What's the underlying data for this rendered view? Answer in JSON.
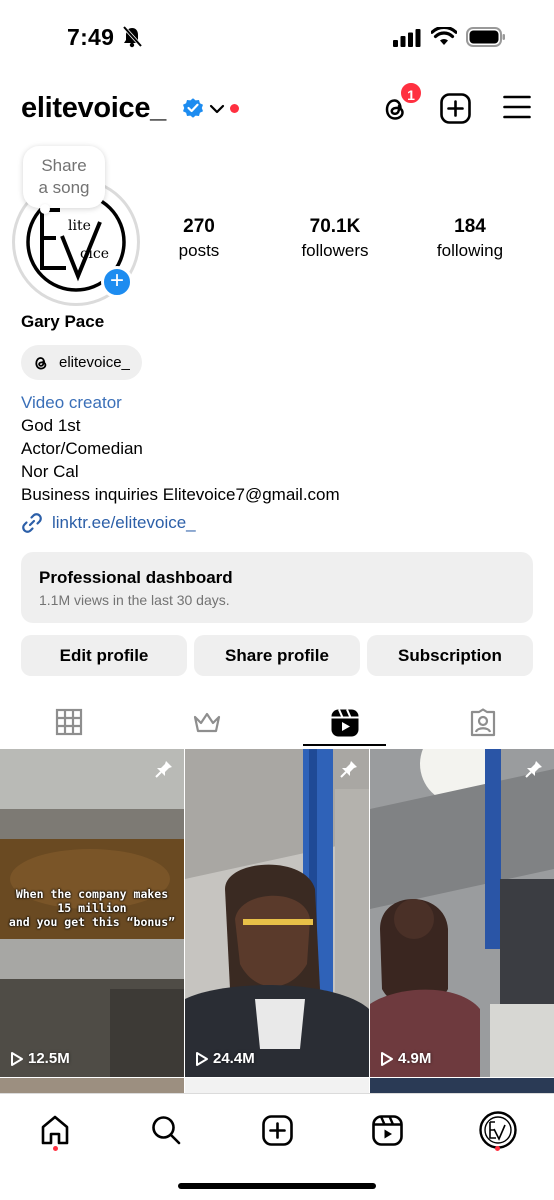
{
  "status_bar": {
    "time": "7:49"
  },
  "header": {
    "username": "elitevoice_",
    "threads_badge": "1",
    "icons": [
      "verified-badge-icon",
      "chevron-down-icon",
      "threads-icon",
      "new-post-icon",
      "menu-icon"
    ]
  },
  "note": {
    "text_line1": "Share",
    "text_line2": "a song"
  },
  "profile": {
    "stats": [
      {
        "value": "270",
        "label": "posts"
      },
      {
        "value": "70.1K",
        "label": "followers"
      },
      {
        "value": "184",
        "label": "following"
      }
    ],
    "full_name": "Gary Pace",
    "threads_handle": "elitevoice_",
    "category": "Video creator",
    "bio_lines": [
      "God 1st",
      "Actor/Comedian",
      "Nor Cal",
      "Business inquiries Elitevoice7@gmail.com"
    ],
    "link": "linktr.ee/elitevoice_"
  },
  "dashboard": {
    "title": "Professional dashboard",
    "subtitle": "1.1M views in the last 30 days."
  },
  "actions": {
    "edit": "Edit profile",
    "share": "Share profile",
    "subscription": "Subscription"
  },
  "tabs": {
    "active": "reels",
    "items": [
      "grid",
      "subscriptions",
      "reels",
      "tagged"
    ]
  },
  "posts": [
    {
      "views": "12.5M",
      "pinned": true,
      "caption_lines": [
        "When the company makes",
        "15 million",
        "and you get this “bonus”"
      ]
    },
    {
      "views": "24.4M",
      "pinned": true
    },
    {
      "views": "4.9M",
      "pinned": true
    }
  ],
  "colors": {
    "accent_blue": "#1d8cf0",
    "link_blue": "#2c5fa8",
    "notification_red": "#ff3040",
    "chip_gray": "#efefef"
  }
}
